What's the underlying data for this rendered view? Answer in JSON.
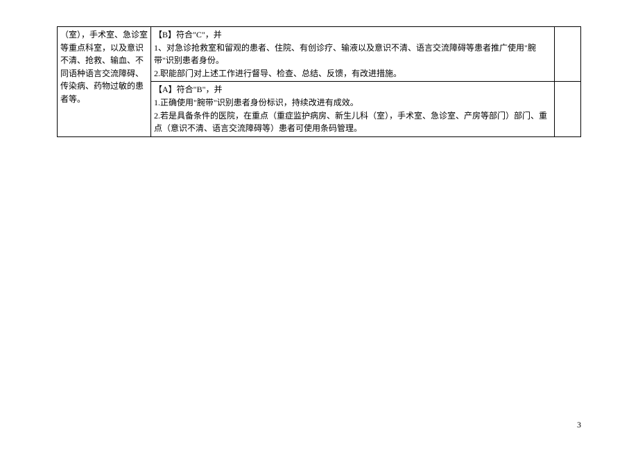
{
  "left_cell_text": "（室），手术室、急诊室等重点科室，以及意识不清、抢救、输血、不同语种语言交流障碍、传染病、药物过敏的患者等。",
  "rows": [
    {
      "header": "【B】符合\"C\"，并",
      "lines": [
        "1、对急诊抢救室和留观的患者、住院、有创诊疗、输液以及意识不清、语言交流障碍等患者推广使用\"腕带\"识别患者身份。",
        "2.职能部门对上述工作进行督导、检查、总结、反馈，有改进措施。"
      ]
    },
    {
      "header": "【A】符合\"B\"，并",
      "lines": [
        "1.正确使用\"腕带\"识别患者身份标识，持续改进有成效。",
        "2.若是具备条件的医院，在重点（重症监护病房、新生儿科（室），手术室、急诊室、产房等部门）部门、重点（意识不清、语言交流障碍等）患者可使用条码管理。"
      ]
    }
  ],
  "page_number": "3"
}
